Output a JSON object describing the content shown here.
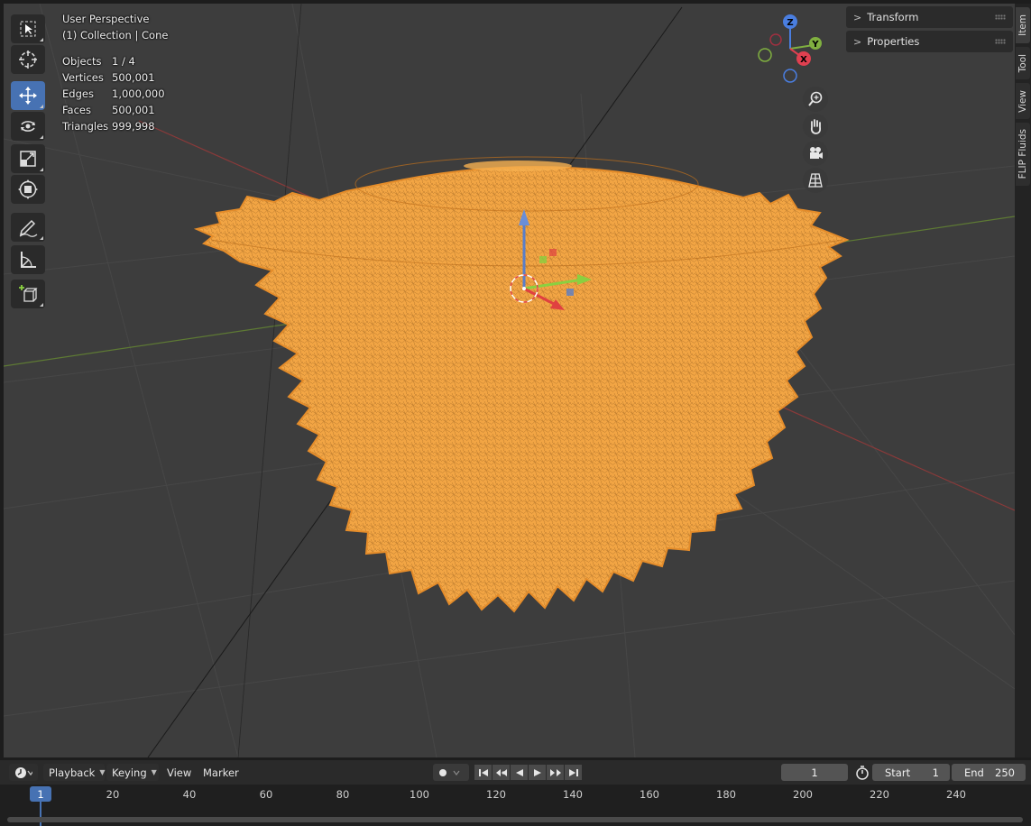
{
  "viewport": {
    "header_line1": "User Perspective",
    "header_line2": "(1) Collection | Cone",
    "stats": [
      {
        "label": "Objects",
        "value": "1 / 4"
      },
      {
        "label": "Vertices",
        "value": "500,001"
      },
      {
        "label": "Edges",
        "value": "1,000,000"
      },
      {
        "label": "Faces",
        "value": "500,001"
      },
      {
        "label": "Triangles",
        "value": "999,998"
      }
    ],
    "gizmo": {
      "z": "Z",
      "y": "Y",
      "x": "X"
    },
    "mesh_color": "#f0a040",
    "accent": "#4772b3"
  },
  "toolbar": {
    "tools": [
      {
        "name": "select-box-tool",
        "icon": "select-box-icon"
      },
      {
        "name": "cursor-tool",
        "icon": "cursor-icon"
      },
      {
        "name": "move-tool",
        "icon": "move-icon",
        "active": true
      },
      {
        "name": "rotate-tool",
        "icon": "rotate-icon"
      },
      {
        "name": "scale-tool",
        "icon": "scale-icon"
      },
      {
        "name": "transform-tool",
        "icon": "transform-icon"
      },
      {
        "name": "annotate-tool",
        "icon": "annotate-icon"
      },
      {
        "name": "measure-tool",
        "icon": "measure-icon"
      },
      {
        "name": "add-cube-tool",
        "icon": "add-cube-icon"
      }
    ]
  },
  "npanel": {
    "transform": "Transform",
    "properties": "Properties"
  },
  "side_tabs": [
    "Item",
    "Tool",
    "View",
    "FLIP Fluids"
  ],
  "timeline": {
    "playback": "Playback",
    "keying": "Keying",
    "view": "View",
    "marker": "Marker",
    "current_frame": "1",
    "start_label": "Start",
    "start_value": "1",
    "end_label": "End",
    "end_value": "250",
    "ruler": [
      "20",
      "40",
      "60",
      "80",
      "100",
      "120",
      "140",
      "160",
      "180",
      "200",
      "220",
      "240"
    ],
    "indicator": "1"
  }
}
